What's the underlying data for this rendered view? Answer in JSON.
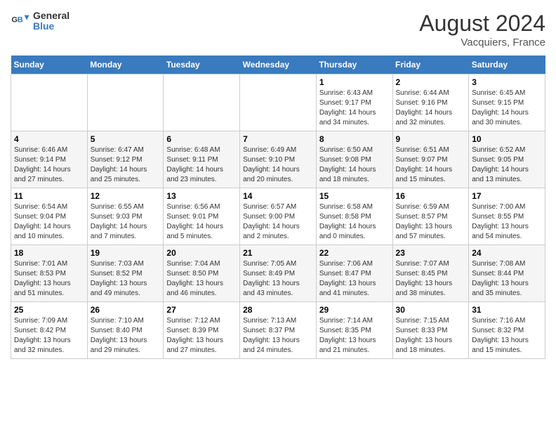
{
  "header": {
    "logo_line1": "General",
    "logo_line2": "Blue",
    "month_year": "August 2024",
    "location": "Vacquiers, France"
  },
  "days_of_week": [
    "Sunday",
    "Monday",
    "Tuesday",
    "Wednesday",
    "Thursday",
    "Friday",
    "Saturday"
  ],
  "weeks": [
    [
      {
        "day": "",
        "info": ""
      },
      {
        "day": "",
        "info": ""
      },
      {
        "day": "",
        "info": ""
      },
      {
        "day": "",
        "info": ""
      },
      {
        "day": "1",
        "info": "Sunrise: 6:43 AM\nSunset: 9:17 PM\nDaylight: 14 hours\nand 34 minutes."
      },
      {
        "day": "2",
        "info": "Sunrise: 6:44 AM\nSunset: 9:16 PM\nDaylight: 14 hours\nand 32 minutes."
      },
      {
        "day": "3",
        "info": "Sunrise: 6:45 AM\nSunset: 9:15 PM\nDaylight: 14 hours\nand 30 minutes."
      }
    ],
    [
      {
        "day": "4",
        "info": "Sunrise: 6:46 AM\nSunset: 9:14 PM\nDaylight: 14 hours\nand 27 minutes."
      },
      {
        "day": "5",
        "info": "Sunrise: 6:47 AM\nSunset: 9:12 PM\nDaylight: 14 hours\nand 25 minutes."
      },
      {
        "day": "6",
        "info": "Sunrise: 6:48 AM\nSunset: 9:11 PM\nDaylight: 14 hours\nand 23 minutes."
      },
      {
        "day": "7",
        "info": "Sunrise: 6:49 AM\nSunset: 9:10 PM\nDaylight: 14 hours\nand 20 minutes."
      },
      {
        "day": "8",
        "info": "Sunrise: 6:50 AM\nSunset: 9:08 PM\nDaylight: 14 hours\nand 18 minutes."
      },
      {
        "day": "9",
        "info": "Sunrise: 6:51 AM\nSunset: 9:07 PM\nDaylight: 14 hours\nand 15 minutes."
      },
      {
        "day": "10",
        "info": "Sunrise: 6:52 AM\nSunset: 9:05 PM\nDaylight: 14 hours\nand 13 minutes."
      }
    ],
    [
      {
        "day": "11",
        "info": "Sunrise: 6:54 AM\nSunset: 9:04 PM\nDaylight: 14 hours\nand 10 minutes."
      },
      {
        "day": "12",
        "info": "Sunrise: 6:55 AM\nSunset: 9:03 PM\nDaylight: 14 hours\nand 7 minutes."
      },
      {
        "day": "13",
        "info": "Sunrise: 6:56 AM\nSunset: 9:01 PM\nDaylight: 14 hours\nand 5 minutes."
      },
      {
        "day": "14",
        "info": "Sunrise: 6:57 AM\nSunset: 9:00 PM\nDaylight: 14 hours\nand 2 minutes."
      },
      {
        "day": "15",
        "info": "Sunrise: 6:58 AM\nSunset: 8:58 PM\nDaylight: 14 hours\nand 0 minutes."
      },
      {
        "day": "16",
        "info": "Sunrise: 6:59 AM\nSunset: 8:57 PM\nDaylight: 13 hours\nand 57 minutes."
      },
      {
        "day": "17",
        "info": "Sunrise: 7:00 AM\nSunset: 8:55 PM\nDaylight: 13 hours\nand 54 minutes."
      }
    ],
    [
      {
        "day": "18",
        "info": "Sunrise: 7:01 AM\nSunset: 8:53 PM\nDaylight: 13 hours\nand 51 minutes."
      },
      {
        "day": "19",
        "info": "Sunrise: 7:03 AM\nSunset: 8:52 PM\nDaylight: 13 hours\nand 49 minutes."
      },
      {
        "day": "20",
        "info": "Sunrise: 7:04 AM\nSunset: 8:50 PM\nDaylight: 13 hours\nand 46 minutes."
      },
      {
        "day": "21",
        "info": "Sunrise: 7:05 AM\nSunset: 8:49 PM\nDaylight: 13 hours\nand 43 minutes."
      },
      {
        "day": "22",
        "info": "Sunrise: 7:06 AM\nSunset: 8:47 PM\nDaylight: 13 hours\nand 41 minutes."
      },
      {
        "day": "23",
        "info": "Sunrise: 7:07 AM\nSunset: 8:45 PM\nDaylight: 13 hours\nand 38 minutes."
      },
      {
        "day": "24",
        "info": "Sunrise: 7:08 AM\nSunset: 8:44 PM\nDaylight: 13 hours\nand 35 minutes."
      }
    ],
    [
      {
        "day": "25",
        "info": "Sunrise: 7:09 AM\nSunset: 8:42 PM\nDaylight: 13 hours\nand 32 minutes."
      },
      {
        "day": "26",
        "info": "Sunrise: 7:10 AM\nSunset: 8:40 PM\nDaylight: 13 hours\nand 29 minutes."
      },
      {
        "day": "27",
        "info": "Sunrise: 7:12 AM\nSunset: 8:39 PM\nDaylight: 13 hours\nand 27 minutes."
      },
      {
        "day": "28",
        "info": "Sunrise: 7:13 AM\nSunset: 8:37 PM\nDaylight: 13 hours\nand 24 minutes."
      },
      {
        "day": "29",
        "info": "Sunrise: 7:14 AM\nSunset: 8:35 PM\nDaylight: 13 hours\nand 21 minutes."
      },
      {
        "day": "30",
        "info": "Sunrise: 7:15 AM\nSunset: 8:33 PM\nDaylight: 13 hours\nand 18 minutes."
      },
      {
        "day": "31",
        "info": "Sunrise: 7:16 AM\nSunset: 8:32 PM\nDaylight: 13 hours\nand 15 minutes."
      }
    ]
  ]
}
